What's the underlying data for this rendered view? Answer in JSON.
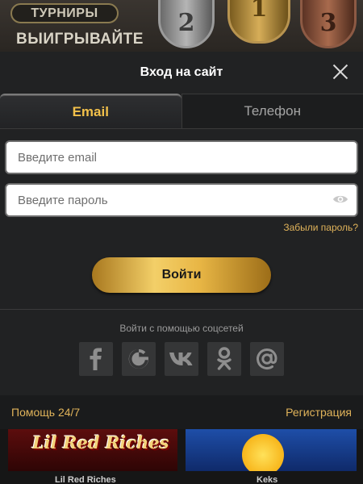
{
  "background": {
    "promo_badge": "ТУРНИРЫ",
    "promo_headline": "ВЫИГРЫВАЙТЕ",
    "trophies": [
      "2",
      "1",
      "3"
    ],
    "games": [
      {
        "logo": "Lil Red Riches",
        "title": "Lil Red Riches"
      },
      {
        "title": "Keks"
      }
    ]
  },
  "modal": {
    "title": "Вход на сайт",
    "close_icon": "close-icon",
    "tabs": [
      {
        "label": "Email",
        "active": true
      },
      {
        "label": "Телефон",
        "active": false
      }
    ],
    "email_field": {
      "value": "",
      "placeholder": "Введите email"
    },
    "password_field": {
      "value": "",
      "placeholder": "Введите пароль",
      "toggle_icon": "eye-icon"
    },
    "forgot_password": "Забыли пароль?",
    "login_button": "Войти",
    "social": {
      "caption": "Войти с помощью соцсетей",
      "providers": [
        "facebook-icon",
        "google-icon",
        "vk-icon",
        "odnoklassniki-icon",
        "mail-icon"
      ]
    },
    "footer": {
      "help": "Помощь 24/7",
      "register": "Регистрация"
    }
  },
  "colors": {
    "accent_gold": "#f2c04a",
    "link_gold": "#e0b35a",
    "modal_bg": "#212223"
  }
}
